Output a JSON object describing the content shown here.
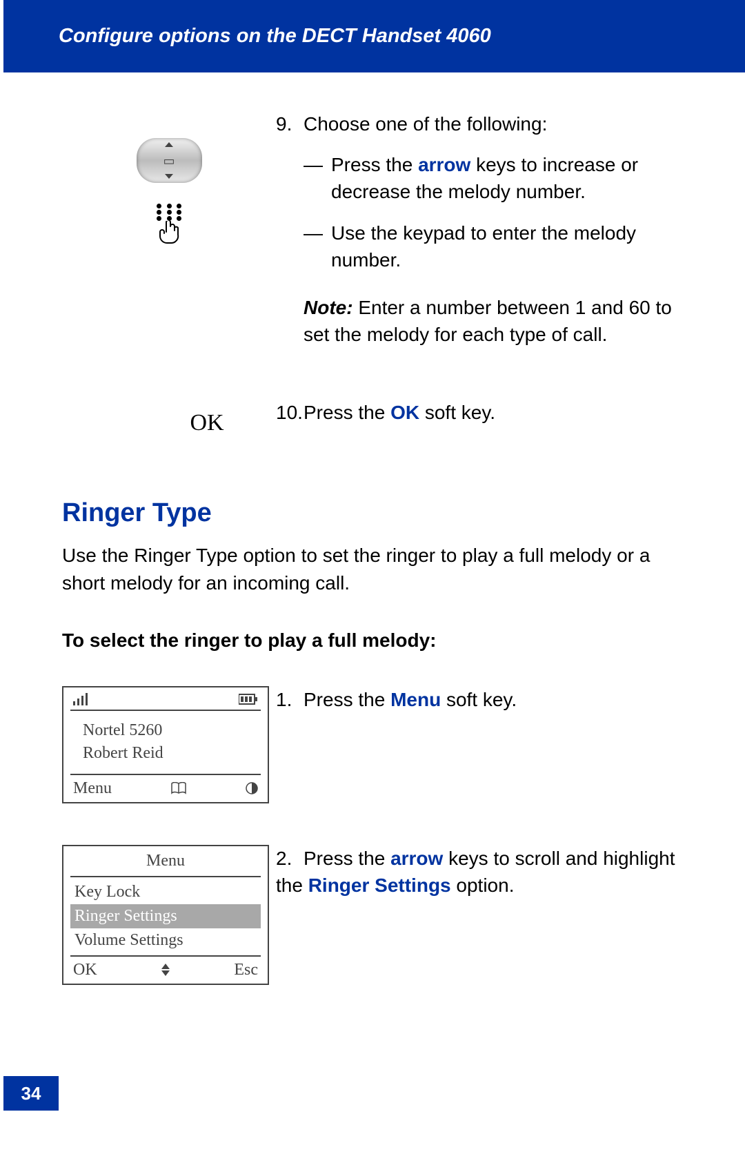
{
  "header": "Configure options on the DECT Handset 4060",
  "page_number": "34",
  "step9": {
    "number": "9.",
    "lead": "Choose one of the following:",
    "dash": "—",
    "bullet1a": "Press the ",
    "bullet1_key": "arrow",
    "bullet1b": " keys to increase or decrease the melody number.",
    "bullet2": "Use the keypad to enter the melody number.",
    "note_label": "Note:",
    "note_text": " Enter a number between 1 and 60 to set the melody for each type of call."
  },
  "step10": {
    "left_label": "OK",
    "number": "10.",
    "text_a": "Press the ",
    "text_key": "OK",
    "text_b": " soft key."
  },
  "section": {
    "heading": "Ringer Type",
    "body": "Use the Ringer Type option to set the ringer to play a full melody or a short melody for an incoming call.",
    "subheading": "To select the ringer to play a full melody:"
  },
  "lcd1": {
    "line1": "Nortel 5260",
    "line2": "Robert Reid",
    "soft_left": "Menu",
    "icon_center_name": "book-open-icon",
    "icon_right_name": "contrast-icon"
  },
  "step_menu1": {
    "number": "1.",
    "text_a": "Press the ",
    "text_key": "Menu",
    "text_b": " soft key."
  },
  "lcd2": {
    "title": "Menu",
    "items": [
      "Key Lock",
      "Ringer Settings",
      "Volume Settings"
    ],
    "highlight_index": 1,
    "soft_left": "OK",
    "soft_right": "Esc"
  },
  "step_menu2": {
    "number": "2.",
    "text_a": "Press the ",
    "text_key1": "arrow",
    "text_b": " keys to scroll and highlight the ",
    "text_key2": "Ringer Settings",
    "text_c": " option."
  },
  "colors": {
    "brand_blue": "#0033a0"
  }
}
